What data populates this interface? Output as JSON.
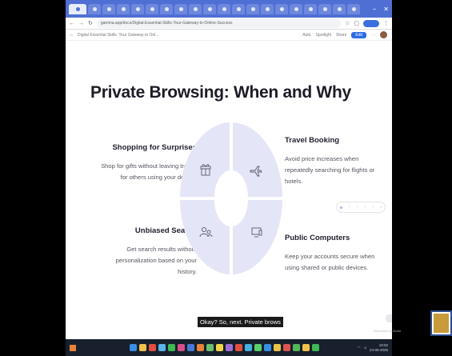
{
  "browser": {
    "url": "gamma.app/docs/Digital-Essential-Skills-Your-Gateway-to-Online-Success",
    "tab_count": 20
  },
  "app": {
    "doc_title": "Digital Essential Skills: Your Gateway to Onl...",
    "zoom": "Auto",
    "spotlight_label": "Spotlight",
    "share_label": "Share",
    "present_label": "Edit"
  },
  "slide": {
    "title": "Private Browsing: When and Why",
    "items": [
      {
        "heading": "Shopping for Surprises",
        "lines": [
          "Shop for gifts without leaving traces",
          "for others using your device."
        ],
        "icon": "gift-icon"
      },
      {
        "heading": "Travel Booking",
        "lines": [
          "Avoid price increases when",
          "repeatedly searching for flights or",
          "hotels."
        ],
        "icon": "airplane-icon"
      },
      {
        "heading": "Unbiased Search",
        "lines": [
          "Get search results without",
          "personalization based on your",
          "history."
        ],
        "icon": "users-icon"
      },
      {
        "heading": "Public Computers",
        "lines": [
          "Keep your accounts secure when",
          "using shared or public devices."
        ],
        "icon": "computer-icon"
      }
    ]
  },
  "caption": "Okay? So, next. Private brows",
  "watermark": "Recorded by Zoom",
  "colors": {
    "wheel_fill": "#e4e5f6",
    "tabbar": "#4f6fd4",
    "taskbar": "#17202c"
  },
  "taskbar_icons": [
    "#3a8ee6",
    "#f0c24a",
    "#e24f3e",
    "#5bb3e8",
    "#3cba54",
    "#d94f8a",
    "#4a78d8",
    "#e8833a",
    "#6bc06b",
    "#f5d547",
    "#9c6fd6",
    "#e24f3e",
    "#46b0e0",
    "#5ad06d",
    "#3a8ee6",
    "#e8c547",
    "#de5353",
    "#56b65a",
    "#f0c24a",
    "#3cba54"
  ],
  "tray": {
    "time": "19:02",
    "date": "24-06-2025"
  }
}
